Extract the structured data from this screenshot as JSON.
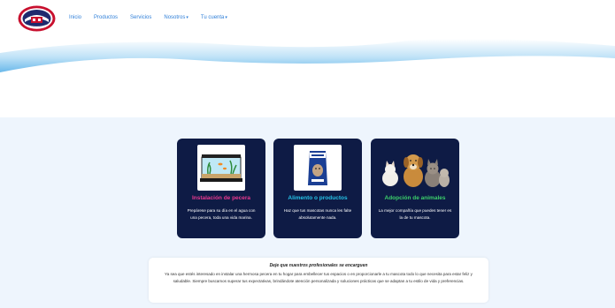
{
  "brand": {
    "logo_text_top": "Pecera La Nueva Era",
    "colors": {
      "red": "#c8102e",
      "navy": "#1e2a6e"
    }
  },
  "nav": {
    "items": [
      {
        "label": "Inicio",
        "dropdown": false
      },
      {
        "label": "Productos",
        "dropdown": false
      },
      {
        "label": "Servicios",
        "dropdown": false
      },
      {
        "label": "Nosotros",
        "dropdown": true
      },
      {
        "label": "Tu cuenta",
        "dropdown": true
      }
    ],
    "link_color": "#2f7fd8"
  },
  "cards": [
    {
      "title": "Instalación de pecera",
      "title_color": "#e8388f",
      "description": "Prepárese para su día en el agua con una pecera, toda una vida marina.",
      "icon": "aquarium-image"
    },
    {
      "title": "Alimento o productos",
      "title_color": "#25c2e8",
      "description": "Haz que tus mascotas nunca les falte absolutamente nada.",
      "icon": "pet-food-bag-image"
    },
    {
      "title": "Adopción de animales",
      "title_color": "#3cd06b",
      "description": "La mejor compañía que puedes tener es la de tu mascota.",
      "icon": "pets-group-image"
    }
  ],
  "info": {
    "heading": "Deje que nuestros profesionales se encarguen",
    "body": "Ya sea que estés interesado en instalar una hermosa pecera en tu hogar para embellecer tus espacios o en proporcionarle a tu mascota todo lo que necesita para estar feliz y saludable. Siempre buscamos superar tus expectativas, brindándote atención personalizada y soluciones prácticas que se adaptan a tu estilo de vida y preferencias."
  },
  "theme": {
    "card_bg": "#0e1b45",
    "section_bg": "#eef5fd",
    "wave": "#7cc4ee"
  }
}
